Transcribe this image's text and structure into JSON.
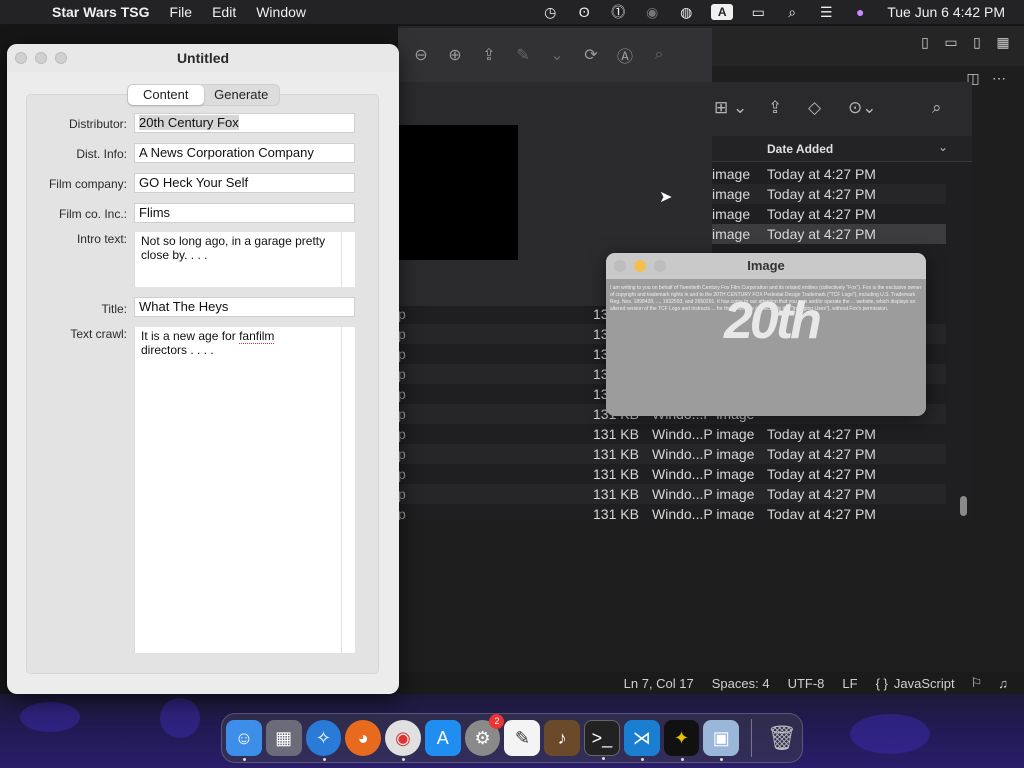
{
  "menubar": {
    "app_name": "Star Wars TSG",
    "menus": [
      "File",
      "Edit",
      "Window"
    ],
    "clock": "Tue Jun 6  4:42 PM",
    "input_source": "A"
  },
  "editor": {
    "status": {
      "position": "Ln 7, Col 17",
      "spaces": "Spaces: 4",
      "encoding": "UTF-8",
      "eol": "LF",
      "braces": "{ }",
      "language": "JavaScript"
    }
  },
  "finder": {
    "column_date": "Date Added",
    "top_rows": [
      {
        "kind": "image",
        "date": "Today at 4:27 PM"
      },
      {
        "kind": "image",
        "date": "Today at 4:27 PM"
      },
      {
        "kind": "image",
        "date": "Today at 4:27 PM"
      },
      {
        "kind": "image",
        "date": "Today at 4:27 PM"
      }
    ],
    "rows": [
      {
        "left": "p",
        "size": "13",
        "type": "",
        "date": ""
      },
      {
        "left": "p",
        "size": "13",
        "type": "",
        "date": ""
      },
      {
        "left": "p",
        "size": "13",
        "type": "",
        "date": ""
      },
      {
        "left": "p",
        "size": "13",
        "type": "",
        "date": ""
      },
      {
        "left": "p",
        "size": "13",
        "type": "",
        "date": ""
      },
      {
        "left": "p",
        "size": "131 KB",
        "type": "Windo...P image",
        "date": ""
      },
      {
        "left": "p",
        "size": "131 KB",
        "type": "Windo...P image",
        "date": "Today at 4:27 PM"
      },
      {
        "left": "p",
        "size": "131 KB",
        "type": "Windo...P image",
        "date": "Today at 4:27 PM"
      },
      {
        "left": "p",
        "size": "131 KB",
        "type": "Windo...P image",
        "date": "Today at 4:27 PM"
      },
      {
        "left": "p",
        "size": "131 KB",
        "type": "Windo...P image",
        "date": "Today at 4:27 PM"
      },
      {
        "left": "p",
        "size": "131 KB",
        "type": "Windo...P image",
        "date": "Today at 4:27 PM"
      }
    ]
  },
  "image_window": {
    "title": "Image",
    "logo": "20th",
    "body_text": "I am writing to you on behalf of Twentieth Century Fox Film Corporation and its related entities (collectively \"Fox\"). Fox is the exclusive owner of copyright and trademark rights in and to the 20TH CENTURY FOX Pedestal Design Trademark (\"TCF Logo\"), including U.S. Trademark Reg. Nos. 1898428, ..., 1932593, and 2650291. It has come to our attention that you own and/or operate the ... website, which displays an altered version of the TCF Logo and instructs ... for their own use (collectively the \"Infringing Uses\"), without Fox's permission."
  },
  "form": {
    "title": "Untitled",
    "tabs": [
      "Content",
      "Generate"
    ],
    "fields": {
      "distributor_label": "Distributor:",
      "distributor": "20th Century Fox",
      "dist_info_label": "Dist. Info:",
      "dist_info": "A News Corporation Company",
      "film_company_label": "Film company:",
      "film_company": "GO Heck Your Self",
      "film_co_inc_label": "Film co. Inc.:",
      "film_co_inc": "Flims",
      "intro_label": "Intro text:",
      "intro": "Not so long ago, in a garage pretty close by. . . .",
      "title_label": "Title:",
      "title": "What The Heys",
      "crawl_label": "Text crawl:",
      "crawl_line1_a": "It is a new age for ",
      "crawl_line1_b": "fanfilm",
      "crawl_line2": "directors . . . ."
    }
  },
  "dock": {
    "apps": [
      "Finder",
      "Launchpad",
      "Safari",
      "Firefox",
      "Chrome",
      "App Store",
      "System Settings",
      "TextEdit",
      "Instruments",
      "Terminal",
      "VS Code",
      "Star Wars TSG",
      "Preview"
    ],
    "settings_badge": "2",
    "trash": "Trash"
  },
  "colors": {
    "accent": "#3b82f6",
    "close": "#ec6a5e",
    "minimize": "#f4bf4f",
    "zoom": "#61c554"
  }
}
